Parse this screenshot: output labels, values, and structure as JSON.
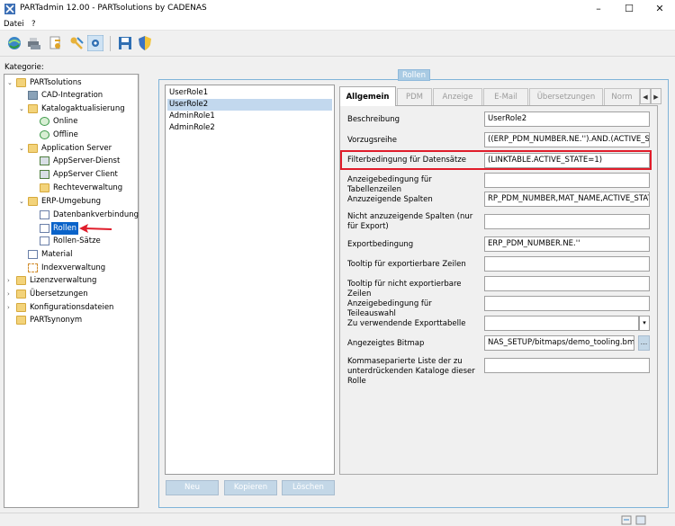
{
  "window": {
    "title": "PARTadmin 12.00 - PARTsolutions by CADENAS",
    "controls": {
      "minimize": "–",
      "maximize": "☐",
      "close": "✕"
    }
  },
  "menu": {
    "items": [
      "Datei",
      "?"
    ]
  },
  "toolbar": {
    "icons": [
      "globe-refresh-icon",
      "printers-icon",
      "key-document-icon",
      "keys-icon",
      "settings-grid-icon",
      "save-icon",
      "shield-icon"
    ]
  },
  "sidebar": {
    "label": "Kategorie:",
    "tree": [
      {
        "label": "PARTsolutions",
        "icon": "folder"
      },
      {
        "label": "CAD-Integration",
        "icon": "cad"
      },
      {
        "label": "Katalogaktualisierung",
        "icon": "folder"
      },
      {
        "label": "Online",
        "icon": "refresh"
      },
      {
        "label": "Offline",
        "icon": "refresh"
      },
      {
        "label": "Application Server",
        "icon": "folder"
      },
      {
        "label": "AppServer-Dienst",
        "icon": "grid"
      },
      {
        "label": "AppServer Client",
        "icon": "grid"
      },
      {
        "label": "Rechteverwaltung",
        "icon": "folder"
      },
      {
        "label": "ERP-Umgebung",
        "icon": "folder"
      },
      {
        "label": "Datenbankverbindung",
        "icon": "doc"
      },
      {
        "label": "Rollen",
        "icon": "doc",
        "selected": true
      },
      {
        "label": "Rollen-Sätze",
        "icon": "doc"
      },
      {
        "label": "Material",
        "icon": "doc"
      },
      {
        "label": "Indexverwaltung",
        "icon": "index"
      },
      {
        "label": "Lizenzverwaltung",
        "icon": "folder"
      },
      {
        "label": "Übersetzungen",
        "icon": "folder"
      },
      {
        "label": "Konfigurationsdateien",
        "icon": "folder"
      },
      {
        "label": "PARTsynonym",
        "icon": "folder"
      }
    ]
  },
  "rollen": {
    "title": "Rollen",
    "roles": [
      "UserRole1",
      "UserRole2",
      "AdminRole1",
      "AdminRole2"
    ],
    "selected_role": "UserRole2",
    "buttons": {
      "new": "Neu",
      "copy": "Kopieren",
      "delete": "Löschen"
    }
  },
  "tabs": [
    "Allgemein",
    "PDM",
    "Anzeige",
    "E-Mail",
    "Übersetzungen",
    "Norm"
  ],
  "active_tab": "Allgemein",
  "form": {
    "fields": [
      {
        "label": "Beschreibung",
        "value": "UserRole2"
      },
      {
        "label": "Vorzugsreihe",
        "value": "((ERP_PDM_NUMBER.NE.'').AND.(ACTIVE_STA"
      },
      {
        "label": "Filterbedingung für Datensätze",
        "value": "(LINKTABLE.ACTIVE_STATE=1)"
      },
      {
        "label": "Anzeigebedingung für Tabellenzeilen",
        "value": ""
      },
      {
        "label": "Anzuzeigende Spalten",
        "value": "RP_PDM_NUMBER,MAT_NAME,ACTIVE_STATE"
      },
      {
        "label": "Nicht anzuzeigende Spalten (nur für Export)",
        "value": ""
      },
      {
        "label": "Exportbedingung",
        "value": "ERP_PDM_NUMBER.NE.''"
      },
      {
        "label": "Tooltip für exportierbare Zeilen",
        "value": ""
      },
      {
        "label": "Tooltip für nicht exportierbare Zeilen",
        "value": ""
      },
      {
        "label": "Anzeigebedingung für Teileauswahl",
        "value": ""
      },
      {
        "label": "Zu verwendende Exporttabelle",
        "value": ""
      },
      {
        "label": "Angezeigtes Bitmap",
        "value": "NAS_SETUP/bitmaps/demo_tooling.bmp"
      },
      {
        "label": "Kommaseparierte Liste der zu unterdrückenden Kataloge dieser Rolle",
        "value": ""
      }
    ],
    "browse_label": "...",
    "dropdown_arrow": "▾"
  },
  "colors": {
    "highlight_box": "#e01c2a",
    "selection": "#0a63c9",
    "group_border": "#7fb3d8"
  }
}
